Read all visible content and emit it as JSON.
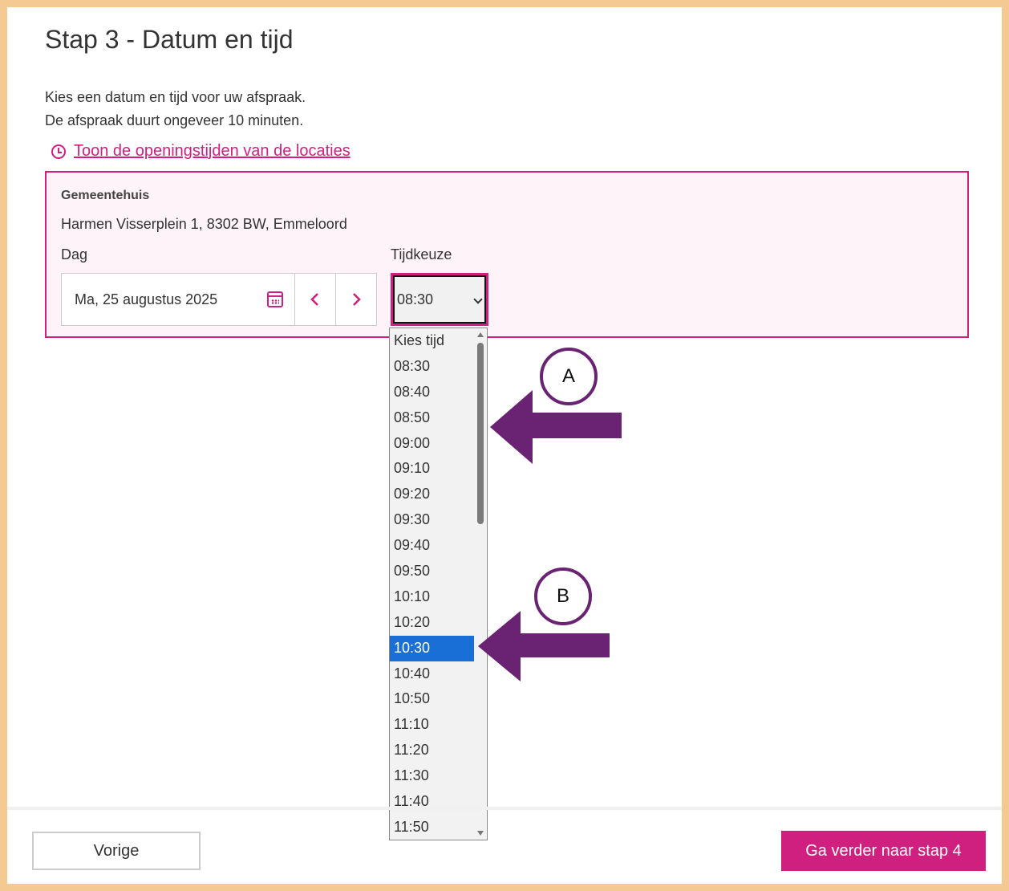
{
  "page": {
    "title": "Stap 3 - Datum en tijd",
    "intro_line1": "Kies een datum en tijd voor uw afspraak.",
    "intro_line2": "De afspraak duurt ongeveer 10 minuten.",
    "hours_link": "Toon de openingstijden van de locaties"
  },
  "location": {
    "name": "Gemeentehuis",
    "address": "Harmen Visserplein 1, 8302 BW, Emmeloord",
    "day_label": "Dag",
    "time_label": "Tijdkeuze",
    "date_value": "Ma, 25 augustus 2025",
    "time_value": "08:30"
  },
  "dropdown": {
    "options": [
      "Kies tijd",
      "08:30",
      "08:40",
      "08:50",
      "09:00",
      "09:10",
      "09:20",
      "09:30",
      "09:40",
      "09:50",
      "10:10",
      "10:20",
      "10:30",
      "10:40",
      "10:50",
      "11:10",
      "11:20",
      "11:30",
      "11:40",
      "11:50"
    ],
    "selected": "10:30"
  },
  "annotations": {
    "a": "A",
    "b": "B",
    "color": "#6a2372"
  },
  "footer": {
    "prev_label": "Vorige",
    "next_label": "Ga verder naar stap 4"
  },
  "colors": {
    "accent": "#d0207f",
    "selected": "#1a6fd6",
    "frame": "#f5c992"
  },
  "icons": {
    "clock": "clock-icon",
    "calendar": "calendar-icon",
    "prev": "chevron-left-icon",
    "next": "chevron-right-icon"
  }
}
